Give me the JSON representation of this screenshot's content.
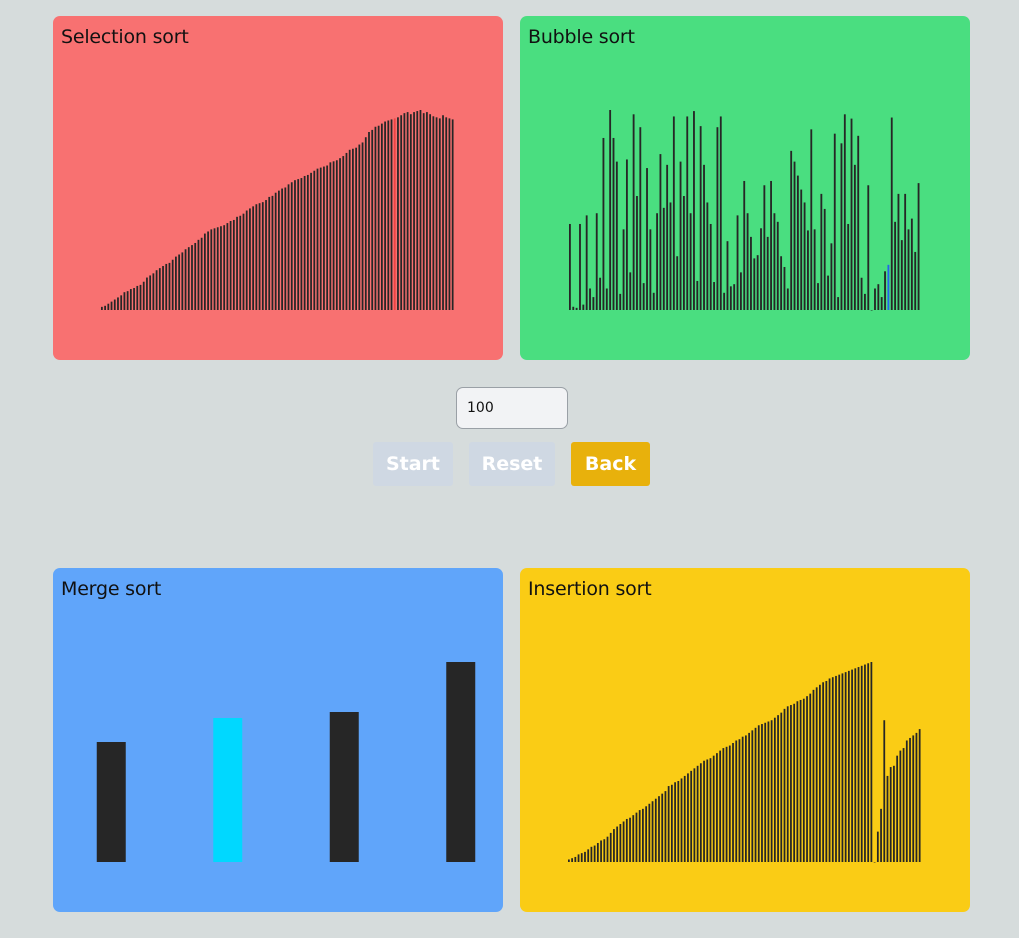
{
  "controls": {
    "size_value": "100",
    "start_label": "Start",
    "reset_label": "Reset",
    "back_label": "Back"
  },
  "colors": {
    "page_background": "#d6dcdc",
    "bar": "#262626",
    "selection_panel": "#f87171",
    "bubble_panel": "#4ade80",
    "merge_panel": "#60a5fa",
    "insertion_panel": "#facc15",
    "selection_highlight": "#ef4444",
    "bubble_highlight": "#2563eb",
    "merge_highlight": "#00d8ff",
    "button_disabled": "#cfd8e3",
    "button_back": "#e8b10c"
  },
  "panels": {
    "selection": {
      "title": "Selection sort",
      "highlight_index": 91,
      "bar_values": [
        3,
        4,
        6,
        8,
        10,
        12,
        14,
        17,
        18,
        20,
        21,
        23,
        24,
        27,
        31,
        33,
        35,
        38,
        40,
        42,
        44,
        45,
        48,
        51,
        53,
        55,
        58,
        60,
        62,
        64,
        67,
        69,
        73,
        75,
        77,
        78,
        79,
        80,
        81,
        83,
        85,
        86,
        89,
        90,
        92,
        95,
        97,
        99,
        101,
        102,
        103,
        105,
        108,
        109,
        112,
        114,
        116,
        117,
        120,
        122,
        124,
        125,
        126,
        128,
        129,
        131,
        133,
        135,
        136,
        137,
        138,
        141,
        142,
        143,
        145,
        147,
        150,
        153,
        154,
        155,
        158,
        160,
        165,
        170,
        172,
        175,
        176,
        178,
        180,
        181,
        182,
        183,
        184,
        186,
        188,
        189,
        187,
        189,
        190,
        191,
        188,
        189,
        187,
        185,
        184,
        183,
        186,
        184,
        183,
        182
      ]
    },
    "bubble": {
      "title": "Bubble sort",
      "highlight_index": 95,
      "bar_values": [
        80,
        3,
        2,
        80,
        5,
        88,
        20,
        12,
        90,
        30,
        160,
        20,
        186,
        160,
        138,
        15,
        75,
        140,
        35,
        182,
        106,
        170,
        25,
        132,
        75,
        16,
        90,
        145,
        95,
        135,
        100,
        180,
        50,
        138,
        106,
        180,
        90,
        185,
        27,
        171,
        135,
        100,
        80,
        26,
        170,
        180,
        16,
        64,
        22,
        24,
        88,
        35,
        120,
        90,
        68,
        48,
        51,
        76,
        116,
        68,
        120,
        90,
        82,
        50,
        40,
        20,
        148,
        138,
        125,
        112,
        100,
        74,
        168,
        75,
        25,
        108,
        94,
        32,
        62,
        164,
        12,
        155,
        182,
        80,
        178,
        135,
        162,
        30,
        15,
        116,
        0,
        20,
        24,
        12,
        36,
        42,
        179,
        82,
        108,
        65,
        108,
        75,
        85,
        54,
        118
      ]
    },
    "merge": {
      "title": "Merge sort",
      "highlight_index": 1,
      "bar_values": [
        60,
        72,
        75,
        100
      ]
    },
    "insertion": {
      "title": "Insertion sort",
      "highlight_index": -1,
      "bar_values": [
        2,
        3,
        4,
        6,
        7,
        8,
        10,
        12,
        13,
        15,
        17,
        18,
        20,
        23,
        26,
        28,
        30,
        32,
        34,
        35,
        37,
        39,
        41,
        42,
        44,
        46,
        48,
        50,
        52,
        54,
        56,
        60,
        61,
        63,
        64,
        66,
        68,
        70,
        72,
        74,
        76,
        78,
        80,
        81,
        82,
        84,
        86,
        88,
        90,
        91,
        92,
        94,
        96,
        97,
        99,
        100,
        102,
        104,
        106,
        108,
        109,
        110,
        111,
        112,
        114,
        116,
        118,
        121,
        123,
        124,
        125,
        127,
        128,
        129,
        131,
        133,
        136,
        138,
        140,
        142,
        143,
        145,
        146,
        147,
        148,
        149,
        150,
        151,
        152,
        153,
        154,
        155,
        156,
        157,
        158,
        0,
        24,
        42,
        112,
        68,
        75,
        76,
        84,
        88,
        90,
        96,
        98,
        100,
        102,
        105
      ]
    }
  }
}
